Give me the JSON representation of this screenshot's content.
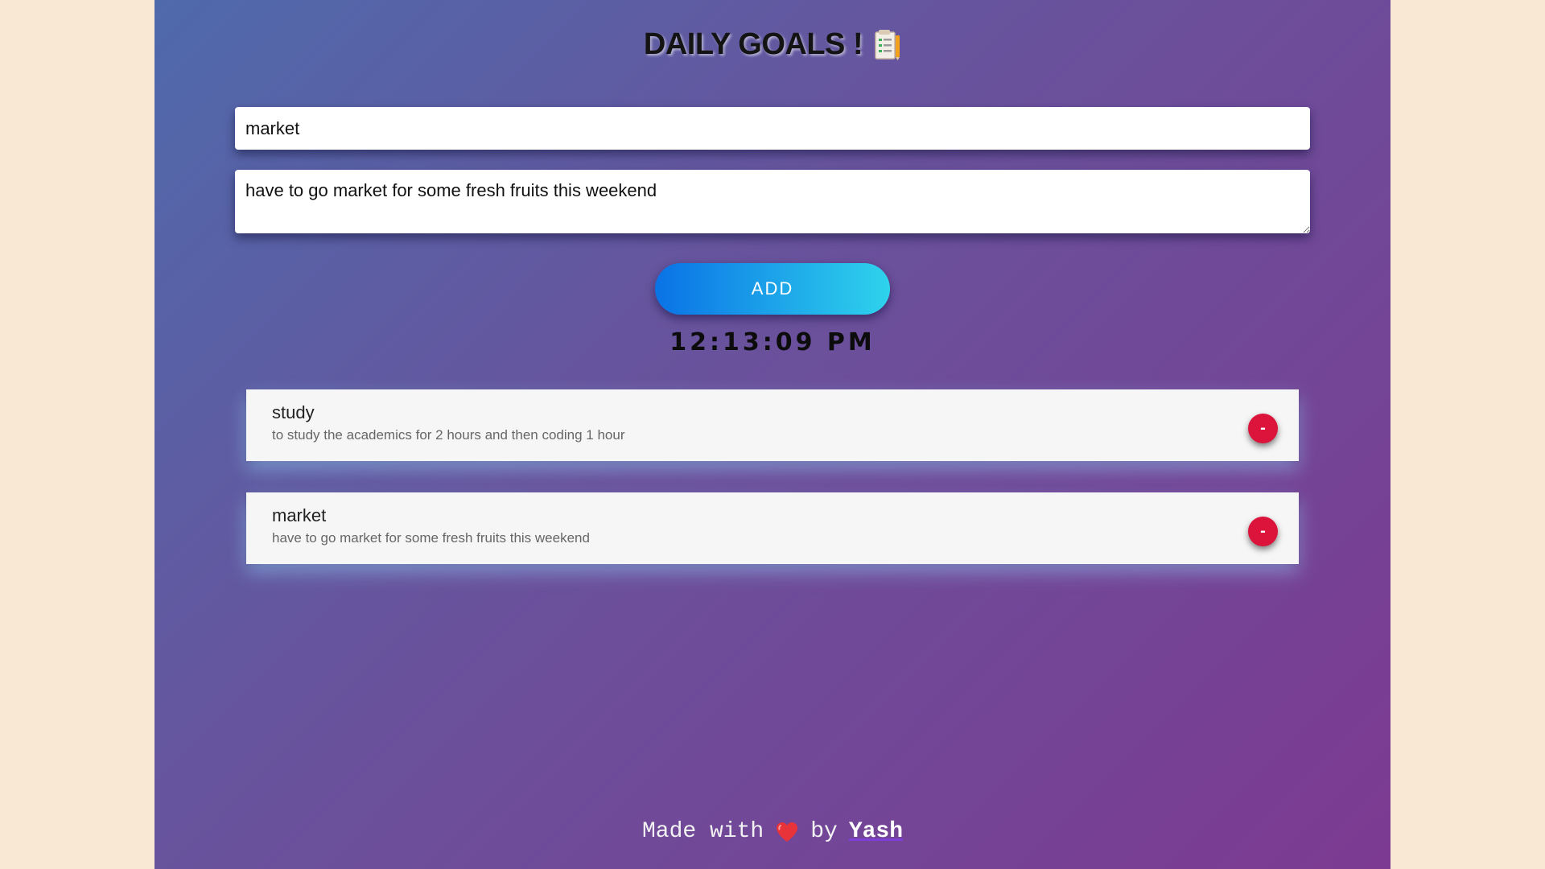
{
  "header": {
    "title": "DAILY GOALS !",
    "icon": "notes-icon"
  },
  "form": {
    "title_value": "market",
    "description_value": "have to go market for some fresh fruits this weekend",
    "add_label": "ADD"
  },
  "clock": {
    "time": "12:13:09 PM"
  },
  "notes": [
    {
      "title": "study",
      "description": "to study the academics for 2 hours and then coding 1 hour",
      "delete_label": "-"
    },
    {
      "title": "market",
      "description": "have to go market for some fresh fruits this weekend",
      "delete_label": "-"
    }
  ],
  "footer": {
    "made_with": "Made with",
    "heart_icon": "heart-icon",
    "by": "by",
    "author": "Yash"
  },
  "colors": {
    "page_bg": "#f9e9d4",
    "gradient_start": "#4f6aab",
    "gradient_end": "#7c3a92",
    "button_start": "#0a72e6",
    "button_end": "#2ed3ec",
    "delete": "#dc143c"
  }
}
